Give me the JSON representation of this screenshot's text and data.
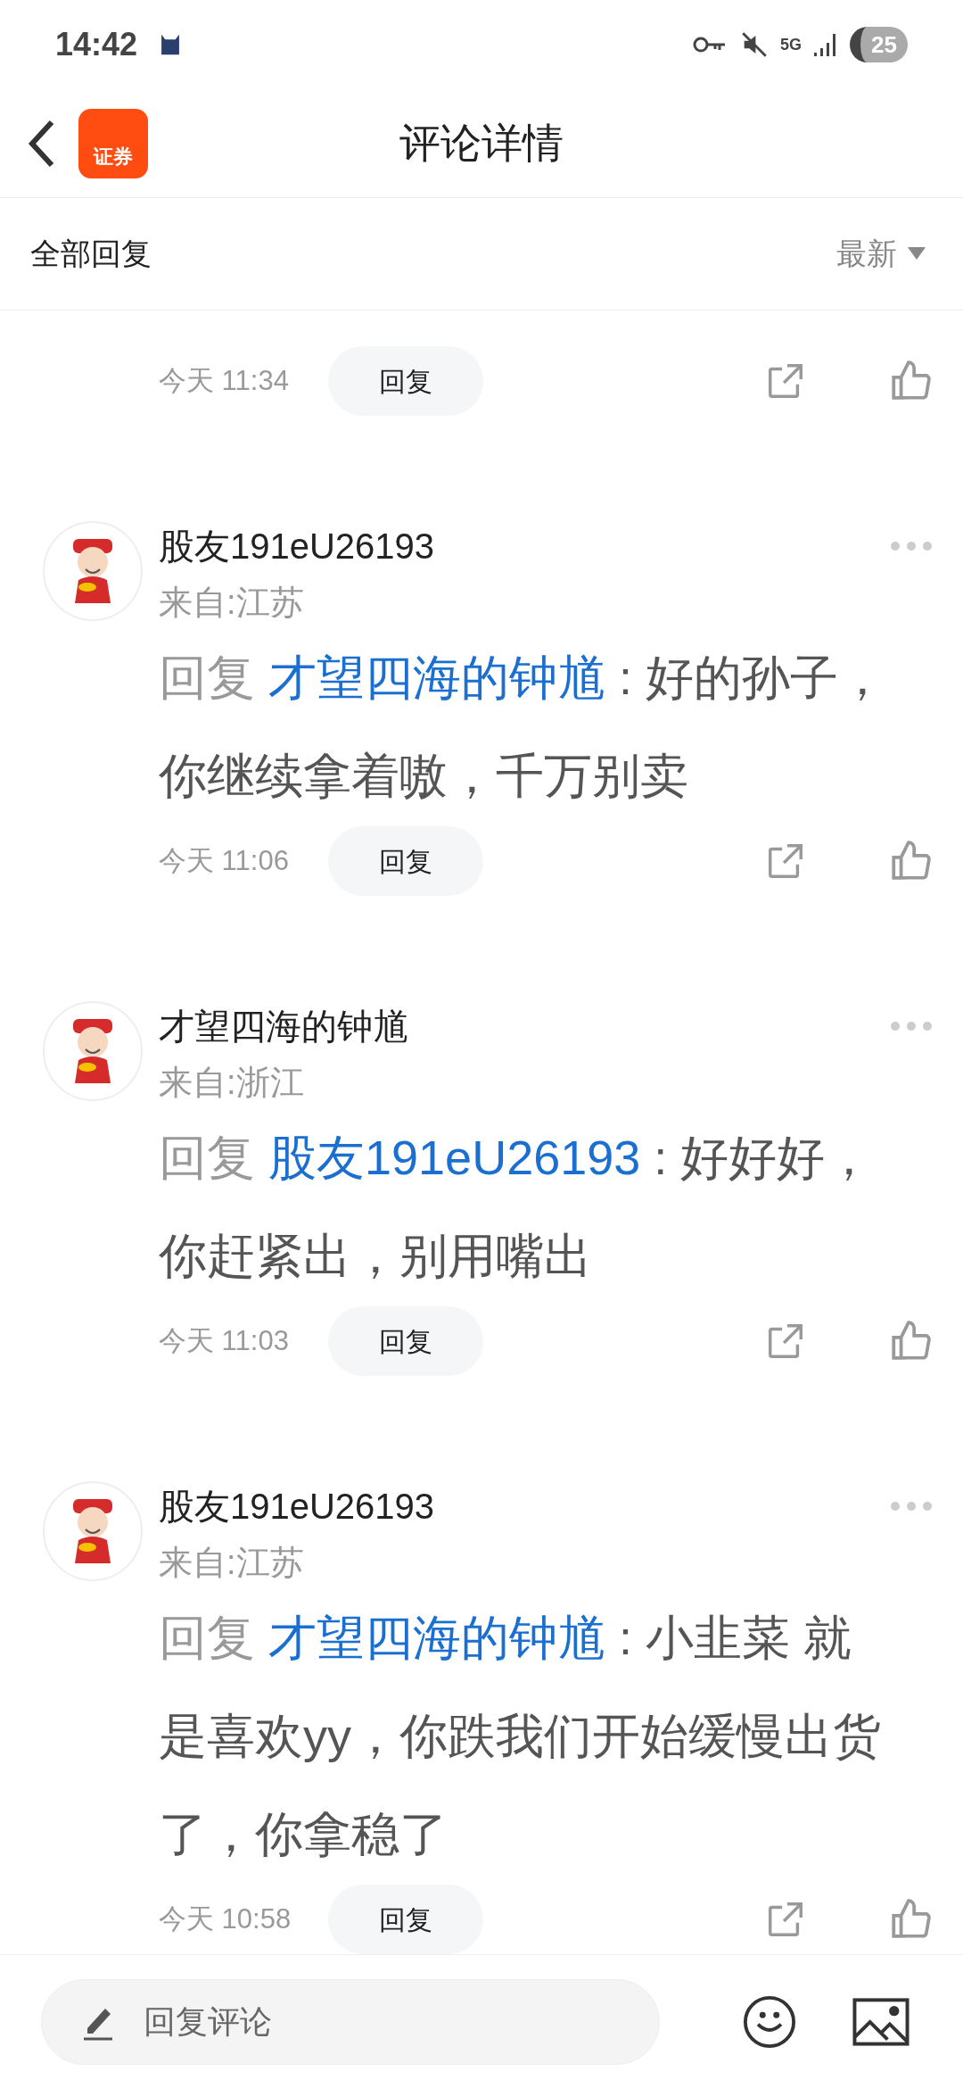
{
  "status_bar": {
    "time": "14:42",
    "network": "5G",
    "battery": "25"
  },
  "header": {
    "title": "评论详情",
    "app_badge": "证券"
  },
  "sort_bar": {
    "label": "全部回复",
    "sort": "最新"
  },
  "partial_comment": {
    "time": "今天 11:34",
    "reply_button": "回复"
  },
  "comments": [
    {
      "name": "股友191eU26193",
      "location": "来自:江苏",
      "prefix": "回复",
      "reply_to": "才望四海的钟馗",
      "text": " : 好的孙子，你继续拿着嗷，千万别卖",
      "time": "今天 11:06",
      "reply_button": "回复"
    },
    {
      "name": "才望四海的钟馗",
      "location": "来自:浙江",
      "prefix": "回复",
      "reply_to": "股友191eU26193",
      "text": " : 好好好，你赶紧出，别用嘴出",
      "time": "今天 11:03",
      "reply_button": "回复"
    },
    {
      "name": "股友191eU26193",
      "location": "来自:江苏",
      "prefix": "回复",
      "reply_to": "才望四海的钟馗",
      "text": " : 小韭菜 就是喜欢yy，你跌我们开始缓慢出货了，你拿稳了",
      "time": "今天 10:58",
      "reply_button": "回复"
    }
  ],
  "composer": {
    "placeholder": "回复评论"
  }
}
